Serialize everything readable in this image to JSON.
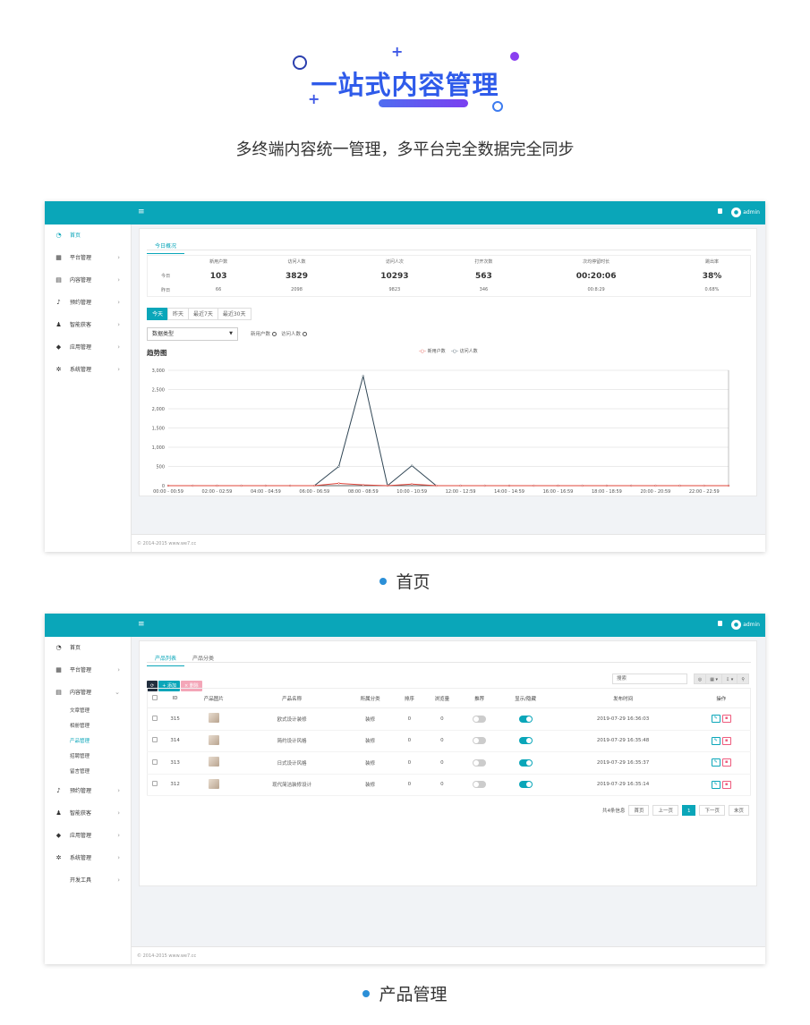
{
  "hero": {
    "title": "一站式内容管理",
    "subtitle": "多终端内容统一管理，多平台完全数据完全同步"
  },
  "captions": {
    "home": "首页",
    "product": "产品管理"
  },
  "app": {
    "user": "admin",
    "footer": "© 2014-2015 www.we7.cc",
    "menu_icon": "bars-icon",
    "accent": "#0aa6b9"
  },
  "sidebar1": [
    {
      "label": "首页",
      "icon": "dashboard-icon",
      "active": true
    },
    {
      "label": "平台管理",
      "icon": "grid-icon"
    },
    {
      "label": "内容管理",
      "icon": "file-icon"
    },
    {
      "label": "预约管理",
      "icon": "bell-icon"
    },
    {
      "label": "智能获客",
      "icon": "users-icon"
    },
    {
      "label": "应用管理",
      "icon": "cube-icon"
    },
    {
      "label": "系统管理",
      "icon": "gear-icon"
    }
  ],
  "sidebar2": {
    "top": [
      {
        "label": "首页",
        "icon": "dashboard-icon"
      },
      {
        "label": "平台管理",
        "icon": "grid-icon"
      },
      {
        "label": "内容管理",
        "icon": "file-icon",
        "expanded": true
      }
    ],
    "subitems": [
      "文章管理",
      "相册管理",
      "产品管理",
      "招聘管理",
      "留言管理"
    ],
    "active_sub": 2,
    "bottom": [
      {
        "label": "预约管理",
        "icon": "bell-icon"
      },
      {
        "label": "智能获客",
        "icon": "users-icon"
      },
      {
        "label": "应用管理",
        "icon": "cube-icon"
      },
      {
        "label": "系统管理",
        "icon": "gear-icon"
      },
      {
        "label": "开发工具",
        "icon": "code-icon"
      }
    ]
  },
  "dashboard": {
    "tab": "今日概况",
    "stats": {
      "headers": [
        "新用户数",
        "访问人数",
        "访问人次",
        "打开次数",
        "次均停留时长",
        "跳出率"
      ],
      "today_label": "今日",
      "yesterday_label": "昨日",
      "today": [
        "103",
        "3829",
        "10293",
        "563",
        "00:20:06",
        "38%"
      ],
      "yesterday": [
        "66",
        "2098",
        "9823",
        "346",
        "00:8:29",
        "0.68%"
      ]
    },
    "range_buttons": [
      "今天",
      "昨天",
      "最近7天",
      "最近30天"
    ],
    "data_type_select": "数据类型",
    "checks": [
      "新用户数",
      "访问人数"
    ],
    "chart_title": "趋势图",
    "legend": [
      "新用户数",
      "访问人数"
    ]
  },
  "chart_data": {
    "type": "line",
    "title": "趋势图",
    "x": [
      "00:00 - 00:59",
      "01:00 - 01:59",
      "02:00 - 02:59",
      "03:00 - 03:59",
      "04:00 - 04:59",
      "05:00 - 05:59",
      "06:00 - 06:59",
      "07:00 - 07:59",
      "08:00 - 08:59",
      "09:00 - 09:59",
      "10:00 - 10:59",
      "11:00 - 11:59",
      "12:00 - 12:59",
      "13:00 - 13:59",
      "14:00 - 14:59",
      "15:00 - 15:59",
      "16:00 - 16:59",
      "17:00 - 17:59",
      "18:00 - 18:59",
      "19:00 - 19:59",
      "20:00 - 20:59",
      "21:00 - 21:59",
      "22:00 - 22:59",
      "23:00 - 23:59"
    ],
    "x_tick_labels": [
      "00:00 - 00:59",
      "02:00 - 02:59",
      "04:00 - 04:59",
      "06:00 - 06:59",
      "08:00 - 08:59",
      "10:00 - 10:59",
      "12:00 - 12:59",
      "14:00 - 14:59",
      "16:00 - 16:59",
      "18:00 - 18:59",
      "20:00 - 20:59",
      "22:00 - 22:59"
    ],
    "yticks": [
      "0",
      "500",
      "1,000",
      "1,500",
      "2,000",
      "2,500",
      "3,000"
    ],
    "ylim": [
      0,
      3000
    ],
    "grid": true,
    "legend_position": "top-right",
    "series": [
      {
        "name": "新用户数",
        "color": "#e0453a",
        "values": [
          0,
          0,
          0,
          0,
          0,
          0,
          0,
          60,
          20,
          0,
          40,
          0,
          0,
          0,
          0,
          0,
          0,
          0,
          0,
          0,
          0,
          0,
          0,
          0
        ]
      },
      {
        "name": "访问人数",
        "color": "#2f4554",
        "values": [
          0,
          0,
          0,
          0,
          0,
          0,
          0,
          500,
          2850,
          0,
          520,
          0,
          0,
          0,
          0,
          0,
          0,
          0,
          0,
          0,
          0,
          0,
          0,
          0
        ]
      }
    ]
  },
  "products": {
    "tabs": [
      "产品列表",
      "产品分类"
    ],
    "toolbar": {
      "add": "添加",
      "delete": "删除",
      "refresh_icon": "refresh-icon"
    },
    "search_placeholder": "搜索",
    "columns": [
      "ID",
      "产品图片",
      "产品名称",
      "所属分类",
      "排序",
      "浏览量",
      "推荐",
      "显示/隐藏",
      "发布时间",
      "操作"
    ],
    "rows": [
      {
        "id": "315",
        "name": "欧式设计装修",
        "category": "装修",
        "sort": "0",
        "views": "0",
        "recommend": false,
        "visible": true,
        "time": "2019-07-29 16:36:03"
      },
      {
        "id": "314",
        "name": "简约设计风格",
        "category": "装修",
        "sort": "0",
        "views": "0",
        "recommend": false,
        "visible": true,
        "time": "2019-07-29 16:35:48"
      },
      {
        "id": "313",
        "name": "日式设计风格",
        "category": "装修",
        "sort": "0",
        "views": "0",
        "recommend": false,
        "visible": true,
        "time": "2019-07-29 16:35:37"
      },
      {
        "id": "312",
        "name": "现代简洁装修设计",
        "category": "装修",
        "sort": "0",
        "views": "0",
        "recommend": false,
        "visible": true,
        "time": "2019-07-29 16:35:14"
      }
    ],
    "pager": {
      "info": "共4条信息",
      "first": "首页",
      "prev": "上一页",
      "current": "1",
      "next": "下一页",
      "last": "末页"
    }
  }
}
